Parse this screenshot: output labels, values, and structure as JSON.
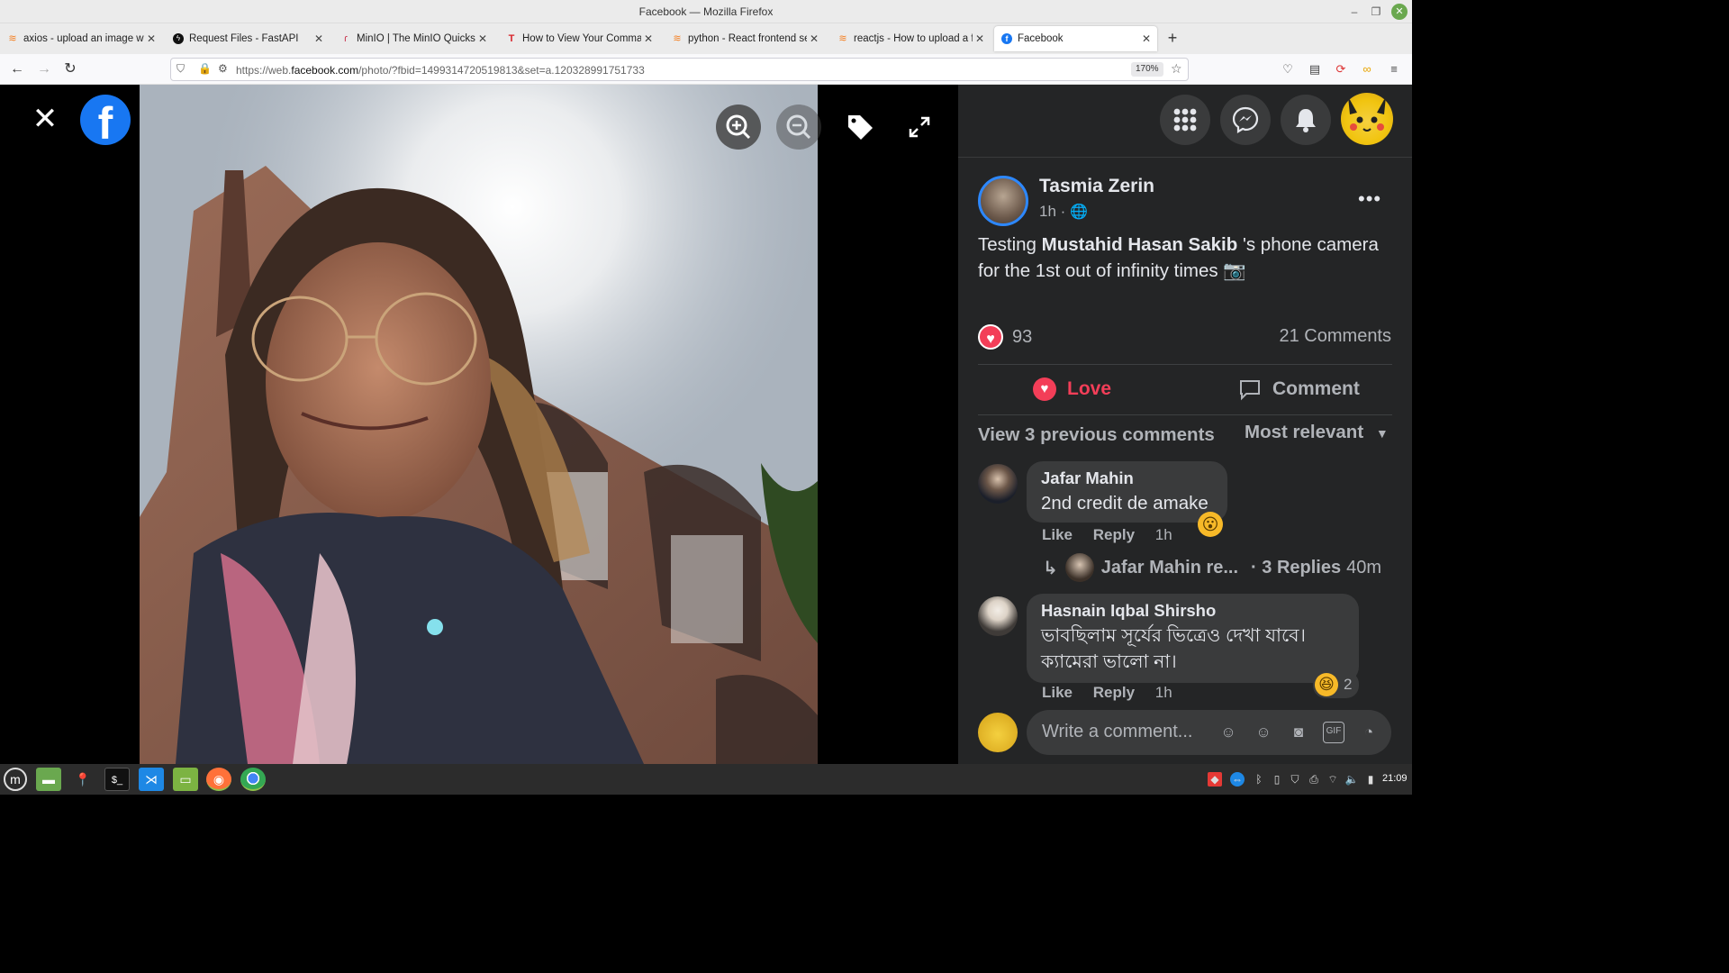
{
  "window": {
    "title": "Facebook — Mozilla Firefox"
  },
  "tabs": [
    {
      "label": "axios - upload an image with",
      "icon": "stackoverflow-icon"
    },
    {
      "label": "Request Files - FastAPI",
      "icon": "fastapi-icon"
    },
    {
      "label": "MinIO | The MinIO Quickstar",
      "icon": "minio-icon"
    },
    {
      "label": "How to View Your Comman",
      "icon": "t-icon"
    },
    {
      "label": "python - React frontend sen",
      "icon": "stackoverflow-icon"
    },
    {
      "label": "reactjs - How to upload a fil",
      "icon": "stackoverflow-icon"
    },
    {
      "label": "Facebook",
      "icon": "facebook-icon",
      "active": true
    }
  ],
  "navbar": {
    "url_prefix": "https://web.",
    "url_domain": "facebook.com",
    "url_path": "/photo/?fbid=1499314720519813&set=a.120328991751733",
    "zoom": "170%"
  },
  "post": {
    "author": "Tasmia Zerin",
    "time": "1h ·",
    "caption_pre": "Testing ",
    "caption_mention": "Mustahid Hasan Sakib",
    "caption_post": " 's phone camera for the 1st out of infinity times 📷",
    "reaction_count": "93",
    "comments_count": "21 Comments",
    "love_label": "Love",
    "comment_label": "Comment",
    "view_previous": "View 3 previous comments",
    "sort_label": "Most relevant"
  },
  "comments": [
    {
      "name": "Jafar Mahin",
      "text": "2nd credit de amake",
      "like": "Like",
      "reply": "Reply",
      "time": "1h",
      "reaction_emoji": "😮"
    },
    {
      "name": "Hasnain Iqbal Shirsho",
      "text_line1": "ভাবছিলাম সূর্যের ভিত্রেও দেখা যাবে।",
      "text_line2": "ক্যামেরা ভালো না।",
      "like": "Like",
      "reply": "Reply",
      "time": "1h",
      "reaction_emoji": "😆",
      "reaction_count": "2"
    }
  ],
  "replies": {
    "preview_name": "Jafar Mahin re...",
    "count_label": "· 3 Replies",
    "time": "40m"
  },
  "composer": {
    "placeholder": "Write a comment..."
  },
  "taskbar": {
    "clock": "21:09"
  },
  "colors": {
    "panel_bg": "#242526",
    "bubble_bg": "#3a3b3c",
    "love_red": "#f33e58",
    "facebook_blue": "#1877f2"
  }
}
